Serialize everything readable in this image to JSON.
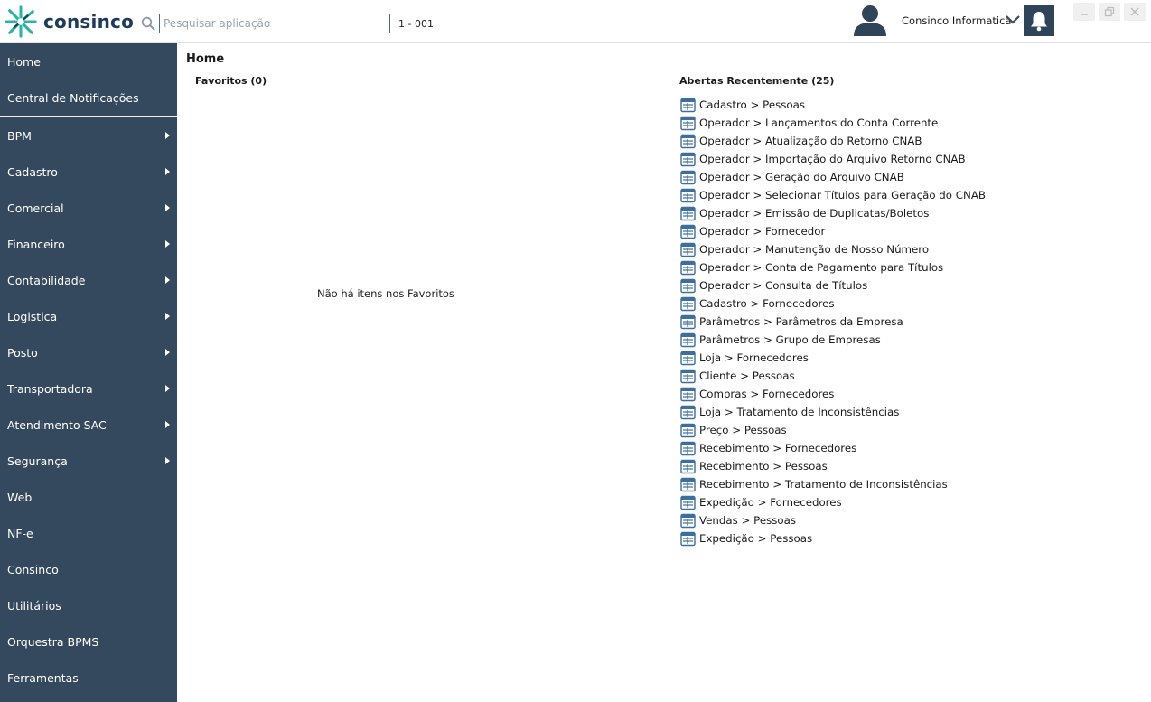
{
  "header": {
    "logo_text": "consinco",
    "search_placeholder": "Pesquisar aplicação",
    "env_code": "1 - 001",
    "user_name": "Consinco Informatica",
    "brand_color": "#1e3b5a",
    "accent_color": "#2bb3a3",
    "icons": [
      "logo-icon",
      "search-icon",
      "user-avatar-icon",
      "chevron-down-icon",
      "bell-icon",
      "minimize-icon",
      "restore-icon",
      "close-icon"
    ]
  },
  "sidebar": {
    "background": "#34495e",
    "top_items": [
      {
        "label": "Home"
      },
      {
        "label": "Central de Notificações"
      }
    ],
    "items": [
      {
        "label": "BPM",
        "submenu": true
      },
      {
        "label": "Cadastro",
        "submenu": true
      },
      {
        "label": "Comercial",
        "submenu": true
      },
      {
        "label": "Financeiro",
        "submenu": true
      },
      {
        "label": "Contabilidade",
        "submenu": true
      },
      {
        "label": "Logistica",
        "submenu": true
      },
      {
        "label": "Posto",
        "submenu": true
      },
      {
        "label": "Transportadora",
        "submenu": true
      },
      {
        "label": "Atendimento SAC",
        "submenu": true
      },
      {
        "label": "Segurança",
        "submenu": true
      },
      {
        "label": "Web",
        "submenu": false
      },
      {
        "label": "NF-e",
        "submenu": false
      },
      {
        "label": "Consinco",
        "submenu": false
      },
      {
        "label": "Utilitários",
        "submenu": false
      },
      {
        "label": "Orquestra BPMS",
        "submenu": false
      },
      {
        "label": "Ferramentas",
        "submenu": false
      }
    ]
  },
  "main": {
    "title": "Home",
    "favorites_title": "Favoritos (0)",
    "favorites_empty": "Não há itens nos Favoritos",
    "recent_title": "Abertas Recentemente (25)",
    "recent": [
      "Cadastro > Pessoas",
      "Operador > Lançamentos do Conta Corrente",
      "Operador > Atualização do Retorno CNAB",
      "Operador > Importação do Arquivo Retorno CNAB",
      "Operador > Geração do Arquivo CNAB",
      "Operador > Selecionar Títulos para Geração do CNAB",
      "Operador > Emissão de Duplicatas/Boletos",
      "Operador > Fornecedor",
      "Operador > Manutenção de Nosso Número",
      "Operador > Conta de Pagamento para Títulos",
      "Operador > Consulta de Títulos",
      "Cadastro > Fornecedores",
      "Parâmetros > Parâmetros da Empresa",
      "Parâmetros > Grupo de Empresas",
      "Loja > Fornecedores",
      "Cliente > Pessoas",
      "Compras > Fornecedores",
      "Loja > Tratamento de Inconsistências",
      "Preço > Pessoas",
      "Recebimento > Fornecedores",
      "Recebimento > Pessoas",
      "Recebimento > Tratamento de Inconsistências",
      "Expedição > Fornecedores",
      "Vendas > Pessoas",
      "Expedição > Pessoas"
    ]
  }
}
